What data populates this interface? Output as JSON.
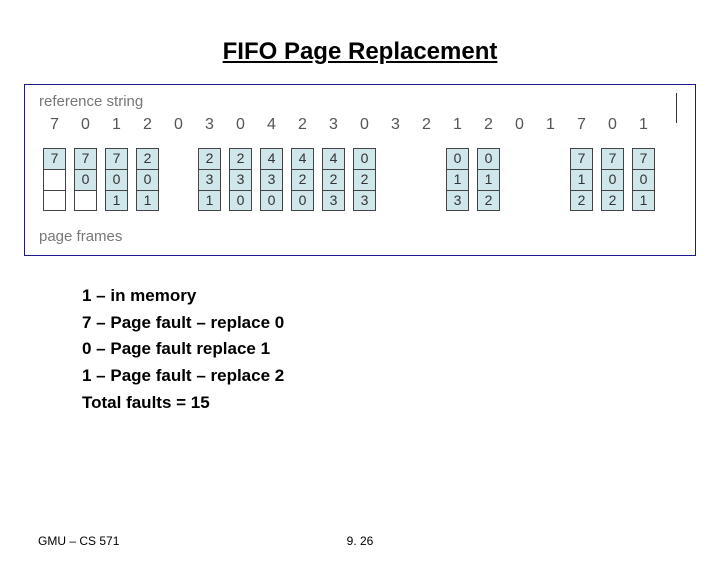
{
  "title": "FIFO Page Replacement",
  "diagram": {
    "ref_label": "reference string",
    "pf_label": "page frames",
    "reference_string": [
      "7",
      "0",
      "1",
      "2",
      "0",
      "3",
      "0",
      "4",
      "2",
      "3",
      "0",
      "3",
      "2",
      "1",
      "2",
      "0",
      "1",
      "7",
      "0",
      "1"
    ],
    "columns": [
      {
        "show": true,
        "cells": [
          "7",
          "",
          ""
        ]
      },
      {
        "show": true,
        "cells": [
          "7",
          "0",
          ""
        ]
      },
      {
        "show": true,
        "cells": [
          "7",
          "0",
          "1"
        ]
      },
      {
        "show": true,
        "cells": [
          "2",
          "0",
          "1"
        ]
      },
      {
        "show": false,
        "cells": []
      },
      {
        "show": true,
        "cells": [
          "2",
          "3",
          "1"
        ]
      },
      {
        "show": true,
        "cells": [
          "2",
          "3",
          "0"
        ]
      },
      {
        "show": true,
        "cells": [
          "4",
          "3",
          "0"
        ]
      },
      {
        "show": true,
        "cells": [
          "4",
          "2",
          "0"
        ]
      },
      {
        "show": true,
        "cells": [
          "4",
          "2",
          "3"
        ]
      },
      {
        "show": true,
        "cells": [
          "0",
          "2",
          "3"
        ]
      },
      {
        "show": false,
        "cells": []
      },
      {
        "show": false,
        "cells": []
      },
      {
        "show": true,
        "cells": [
          "0",
          "1",
          "3"
        ]
      },
      {
        "show": true,
        "cells": [
          "0",
          "1",
          "2"
        ]
      },
      {
        "show": false,
        "cells": []
      },
      {
        "show": false,
        "cells": []
      },
      {
        "show": true,
        "cells": [
          "7",
          "1",
          "2"
        ]
      },
      {
        "show": true,
        "cells": [
          "7",
          "0",
          "2"
        ]
      },
      {
        "show": true,
        "cells": [
          "7",
          "0",
          "1"
        ]
      }
    ]
  },
  "bullets": [
    "1 – in memory",
    "7 – Page fault – replace 0",
    "0 – Page fault replace 1",
    "1 – Page fault – replace 2",
    "Total faults = 15"
  ],
  "footer": {
    "left": "GMU – CS 571",
    "center": "9. 26"
  }
}
